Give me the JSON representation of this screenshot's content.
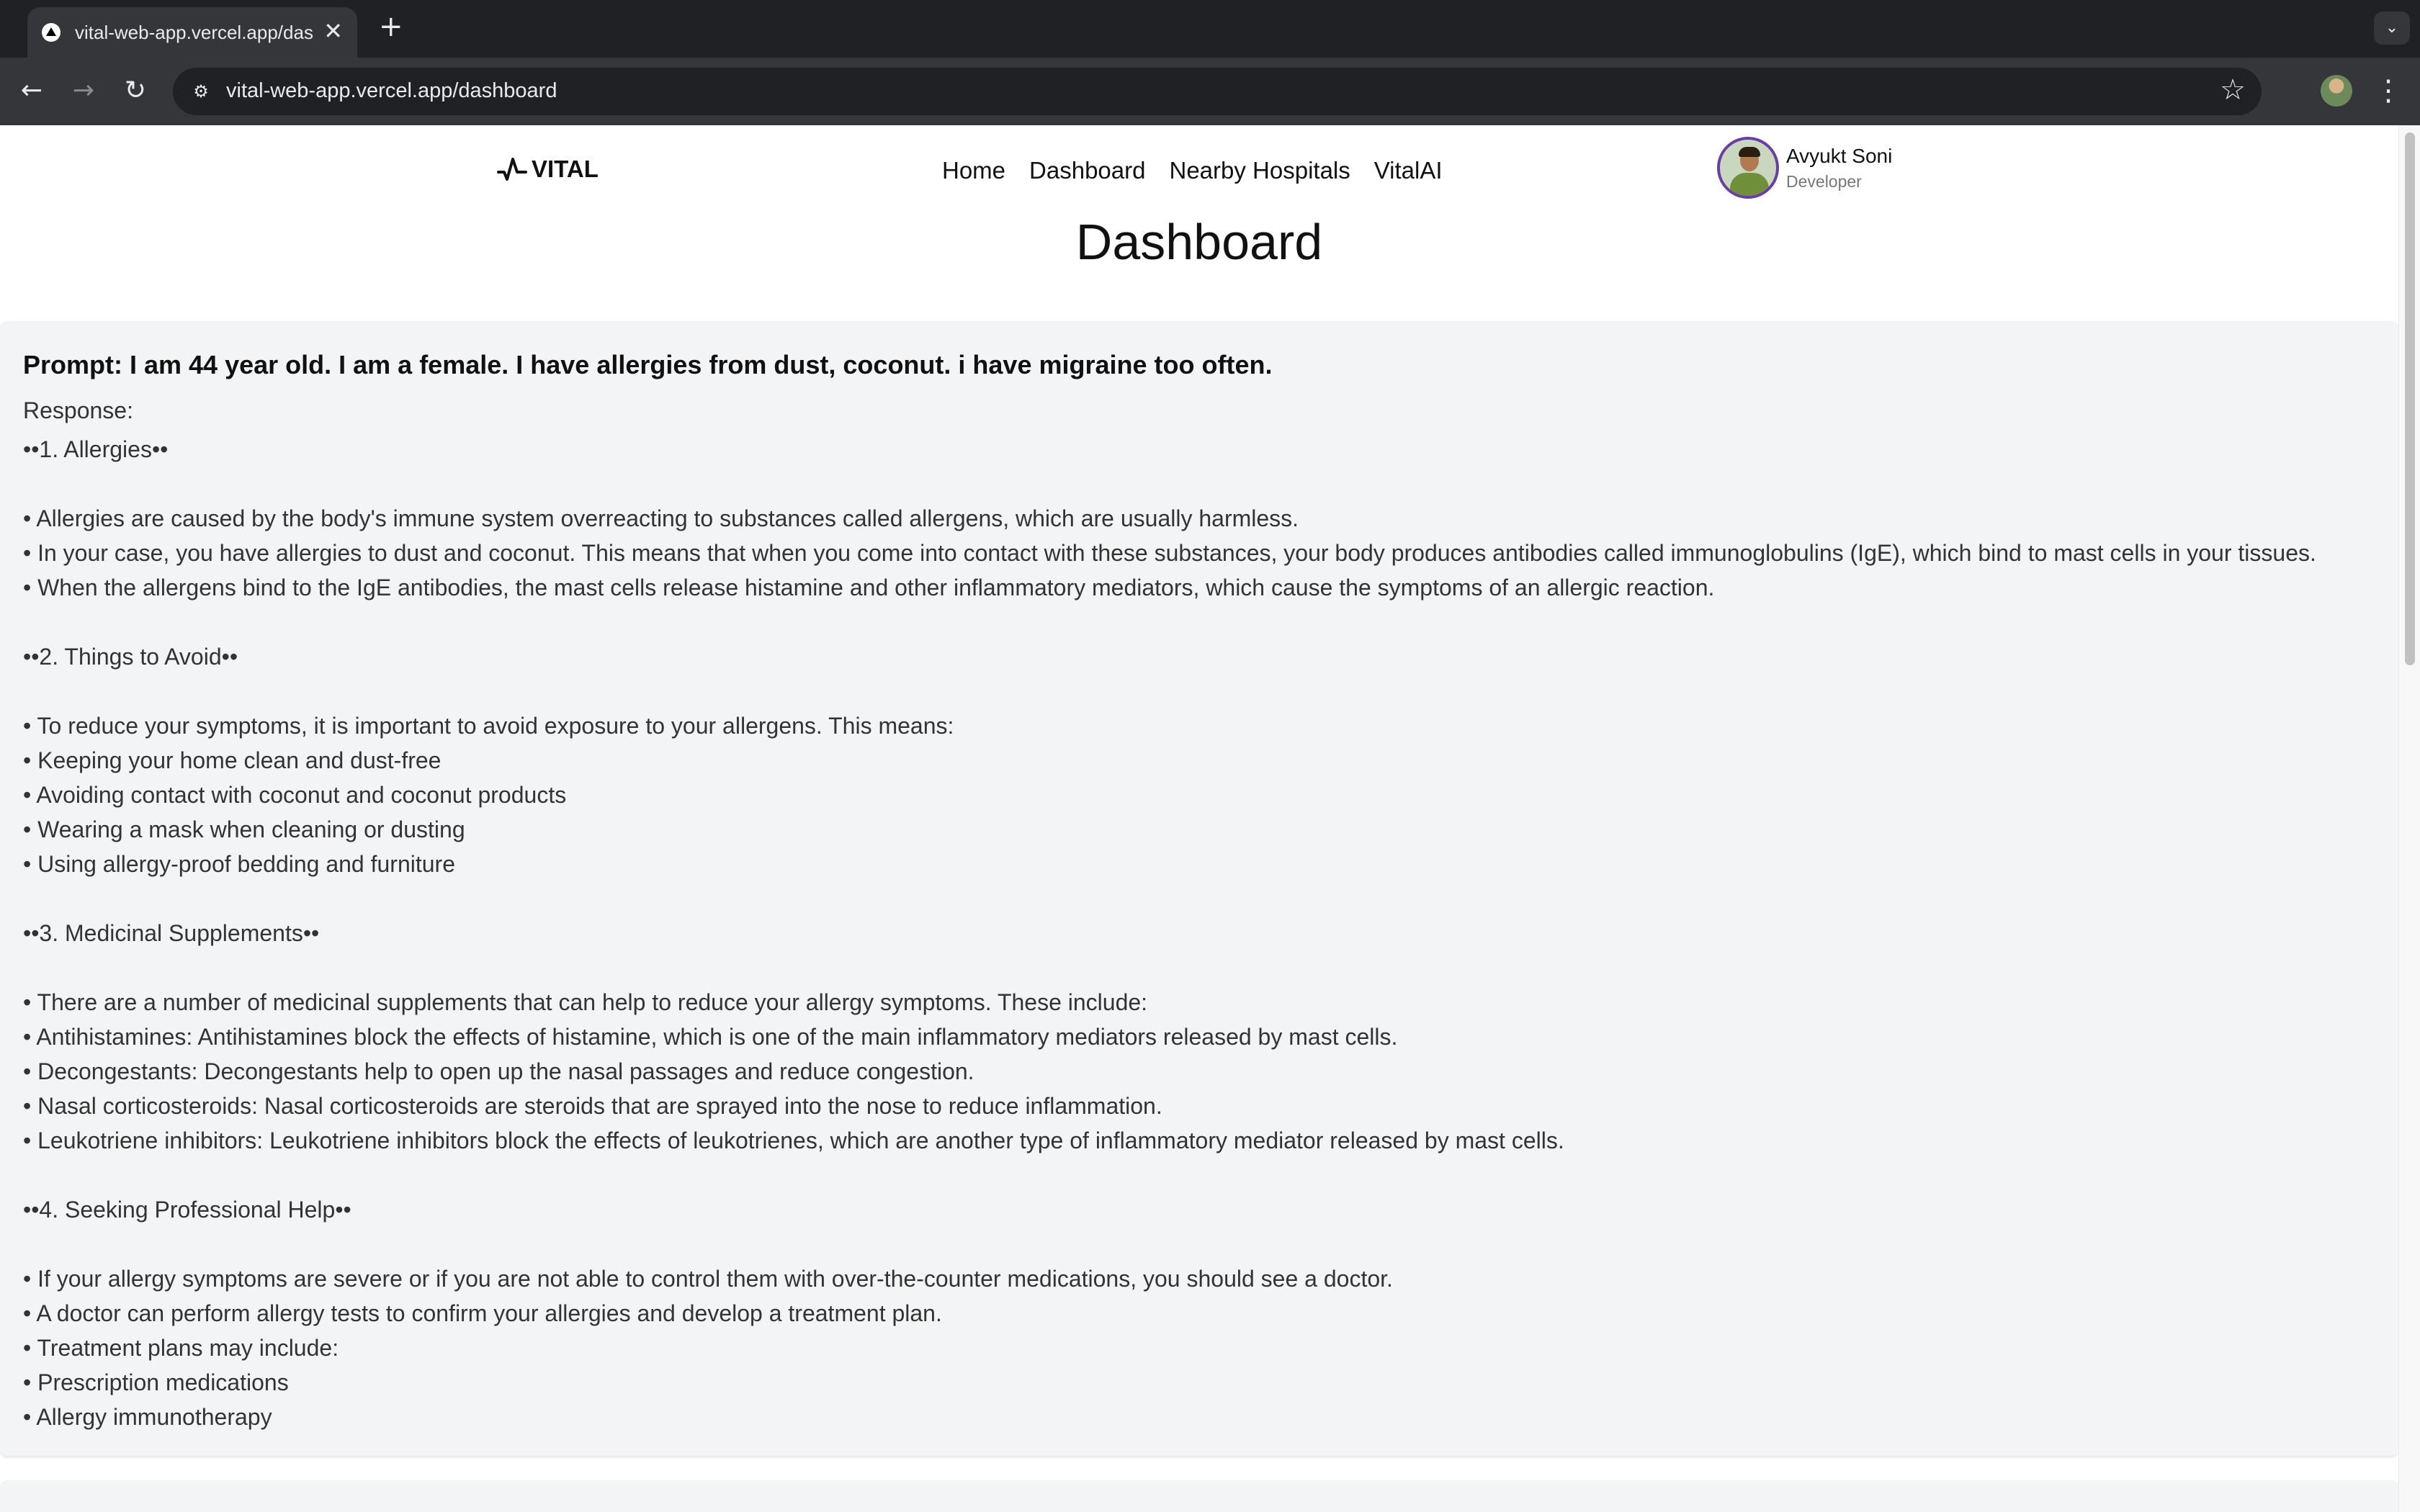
{
  "browser": {
    "tab_title": "vital-web-app.vercel.app/das",
    "tab_close": "✕",
    "new_tab": "+",
    "tab_menu": "⌄",
    "back": "←",
    "forward": "→",
    "reload": "↻",
    "site_info": "⚙",
    "url_host": "vital-web-app.vercel.app",
    "url_path": "/dashboard",
    "star": "☆",
    "menu": "⋮"
  },
  "site": {
    "logo_text": "VITAL",
    "nav": [
      "Home",
      "Dashboard",
      "Nearby Hospitals",
      "VitalAI"
    ],
    "user": {
      "name": "Avyukt Soni",
      "role": "Developer"
    }
  },
  "page": {
    "title": "Dashboard",
    "prompt": "Prompt: I am 44 year old. I am a female. I have allergies from dust, coconut. i have migraine too often.",
    "response_label": "Response:",
    "response_lines": [
      "••1. Allergies••",
      "",
      "• Allergies are caused by the body's immune system overreacting to substances called allergens, which are usually harmless.",
      "• In your case, you have allergies to dust and coconut. This means that when you come into contact with these substances, your body produces antibodies called immunoglobulins (IgE), which bind to mast cells in your tissues.",
      "• When the allergens bind to the IgE antibodies, the mast cells release histamine and other inflammatory mediators, which cause the symptoms of an allergic reaction.",
      "",
      "••2. Things to Avoid••",
      "",
      "• To reduce your symptoms, it is important to avoid exposure to your allergens. This means:",
      "• Keeping your home clean and dust-free",
      "• Avoiding contact with coconut and coconut products",
      "• Wearing a mask when cleaning or dusting",
      "• Using allergy-proof bedding and furniture",
      "",
      "••3. Medicinal Supplements••",
      "",
      "• There are a number of medicinal supplements that can help to reduce your allergy symptoms. These include:",
      "• Antihistamines: Antihistamines block the effects of histamine, which is one of the main inflammatory mediators released by mast cells.",
      "• Decongestants: Decongestants help to open up the nasal passages and reduce congestion.",
      "• Nasal corticosteroids: Nasal corticosteroids are steroids that are sprayed into the nose to reduce inflammation.",
      "• Leukotriene inhibitors: Leukotriene inhibitors block the effects of leukotrienes, which are another type of inflammatory mediator released by mast cells.",
      "",
      "••4. Seeking Professional Help••",
      "",
      "• If your allergy symptoms are severe or if you are not able to control them with over-the-counter medications, you should see a doctor.",
      "• A doctor can perform allergy tests to confirm your allergies and develop a treatment plan.",
      "• Treatment plans may include:",
      "• Prescription medications",
      "• Allergy immunotherapy"
    ]
  }
}
